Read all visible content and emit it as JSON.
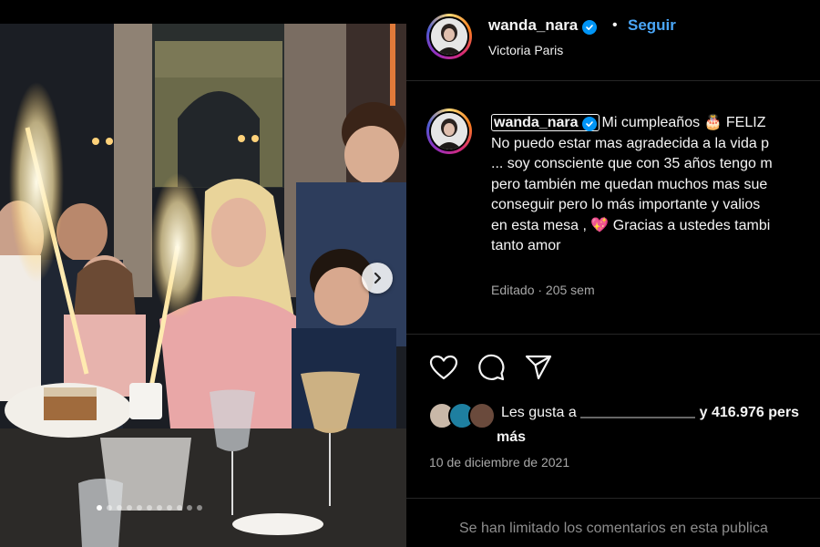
{
  "post": {
    "username": "wanda_nara",
    "follow_label": "Seguir",
    "separator": "•",
    "location": "Victoria Paris",
    "caption": {
      "username": "wanda_nara",
      "line1": "Mi cumpleaños 🎂 FELIZ",
      "line2": "No puedo estar mas agradecida a la vida p",
      "line3": "... soy consciente que con 35 años tengo m",
      "line4": "pero también me quedan muchos mas sue",
      "line5": "conseguir pero lo más importante y valios",
      "line6": "en esta mesa ,  💖  Gracias a ustedes tambi",
      "line7": "tanto amor"
    },
    "meta": "Editado · 205 sem",
    "likes_prefix": "Les gusta a",
    "likes_suffix": "y 416.976 pers",
    "likes_more": "más",
    "date": "10 de diciembre de 2021",
    "comments_limited": "Se han limitado los comentarios en esta publica"
  },
  "carousel": {
    "slide_count": 11,
    "active_index": 0
  },
  "icons": {
    "verified": "verified-badge-icon",
    "like": "heart-icon",
    "comment": "comment-icon",
    "share": "share-icon",
    "next": "chevron-right-icon"
  },
  "colors": {
    "background": "#000000",
    "text": "#f5f5f5",
    "muted": "#a8a8a8",
    "follow": "#4aa6f7",
    "verified": "#0095f6"
  }
}
